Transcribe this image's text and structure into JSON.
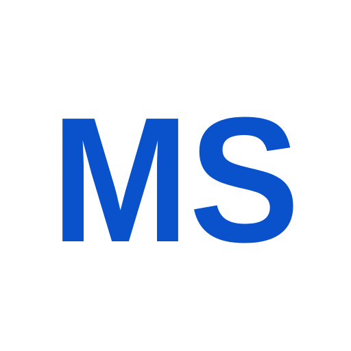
{
  "logo": {
    "text": "MS",
    "color": "#0a52cc",
    "background": "#ffffff"
  }
}
